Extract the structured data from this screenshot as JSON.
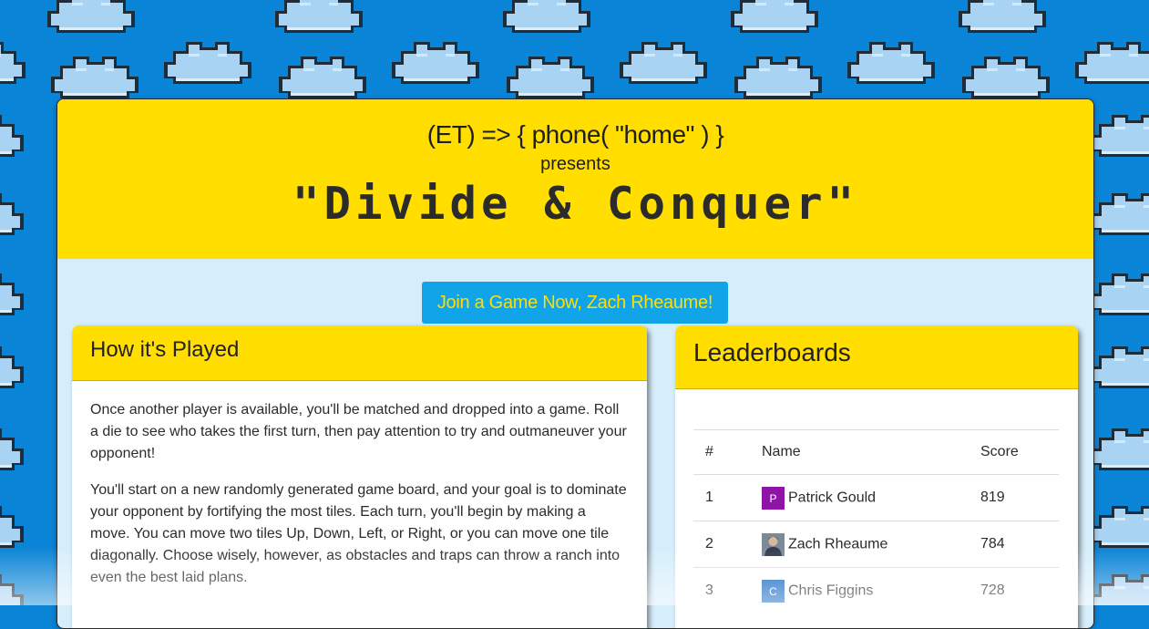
{
  "colors": {
    "sky": "#0a84d6",
    "cloud": "#a9d3f2",
    "brand_yellow": "#ffde00",
    "panel_bg": "#d6eefb",
    "button_bg": "#12a4e8"
  },
  "hero": {
    "tagline": "(ET) => { phone( \"home\" ) }",
    "presents": "presents",
    "title": "\"Divide & Conquer\""
  },
  "join_button": {
    "label": "Join a Game Now, Zach Rheaume!"
  },
  "how_to_play": {
    "title": "How it's Played",
    "paragraphs": [
      "Once another player is available, you'll be matched and dropped into a game. Roll a die to see who takes the first turn, then pay attention to try and outmaneuver your opponent!",
      "You'll start on a new randomly generated game board, and your goal is to dominate your opponent by fortifying the most tiles. Each turn, you'll begin by making a move. You can move two tiles Up, Down, Left, or Right, or you can move one tile diagonally. Choose wisely, however, as obstacles and traps can throw a ranch into even the best laid plans."
    ]
  },
  "leaderboard": {
    "title": "Leaderboards",
    "columns": [
      "#",
      "Name",
      "Score"
    ],
    "rows": [
      {
        "rank": "1",
        "name": "Patrick Gould",
        "score": "819",
        "avatar_letter": "P",
        "avatar_color": "#8e14a8",
        "avatar_icon": "letter-avatar"
      },
      {
        "rank": "2",
        "name": "Zach Rheaume",
        "score": "784",
        "avatar_letter": "",
        "avatar_color": "#6b7c8e",
        "avatar_icon": "photo-avatar"
      },
      {
        "rank": "3",
        "name": "Chris Figgins",
        "score": "728",
        "avatar_letter": "C",
        "avatar_color": "#1565c0",
        "avatar_icon": "letter-avatar"
      }
    ]
  }
}
